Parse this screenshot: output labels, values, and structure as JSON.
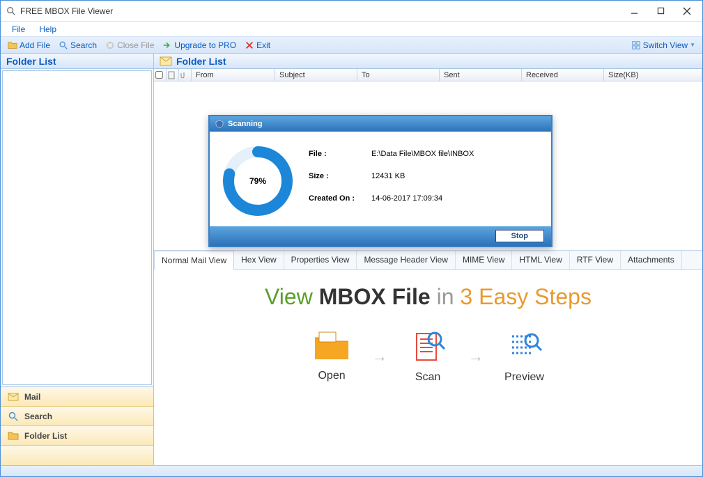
{
  "window": {
    "title": "FREE MBOX File Viewer"
  },
  "menubar": {
    "file": "File",
    "help": "Help"
  },
  "toolbar": {
    "add_file": "Add File",
    "search": "Search",
    "close_file": "Close File",
    "upgrade": "Upgrade to PRO",
    "exit": "Exit",
    "switch_view": "Switch View"
  },
  "left": {
    "header": "Folder List",
    "nav_mail": "Mail",
    "nav_search": "Search",
    "nav_folder": "Folder List"
  },
  "right": {
    "header": "Folder List",
    "columns": {
      "from": "From",
      "subject": "Subject",
      "to": "To",
      "sent": "Sent",
      "received": "Received",
      "size": "Size(KB)"
    }
  },
  "scan": {
    "title": "Scanning",
    "percent": "79%",
    "file_label": "File :",
    "file_value": "E:\\Data File\\MBOX file\\INBOX",
    "size_label": "Size :",
    "size_value": "12431 KB",
    "created_label": "Created On :",
    "created_value": "14-06-2017 17:09:34",
    "stop": "Stop"
  },
  "tabs": {
    "normal": "Normal Mail View",
    "hex": "Hex View",
    "properties": "Properties View",
    "header": "Message Header View",
    "mime": "MIME View",
    "html": "HTML View",
    "rtf": "RTF View",
    "attach": "Attachments"
  },
  "promo": {
    "w1": "View",
    "w2": "MBOX File",
    "w3": "in",
    "w4": "3 Easy Steps",
    "step1": "Open",
    "step2": "Scan",
    "step3": "Preview"
  }
}
